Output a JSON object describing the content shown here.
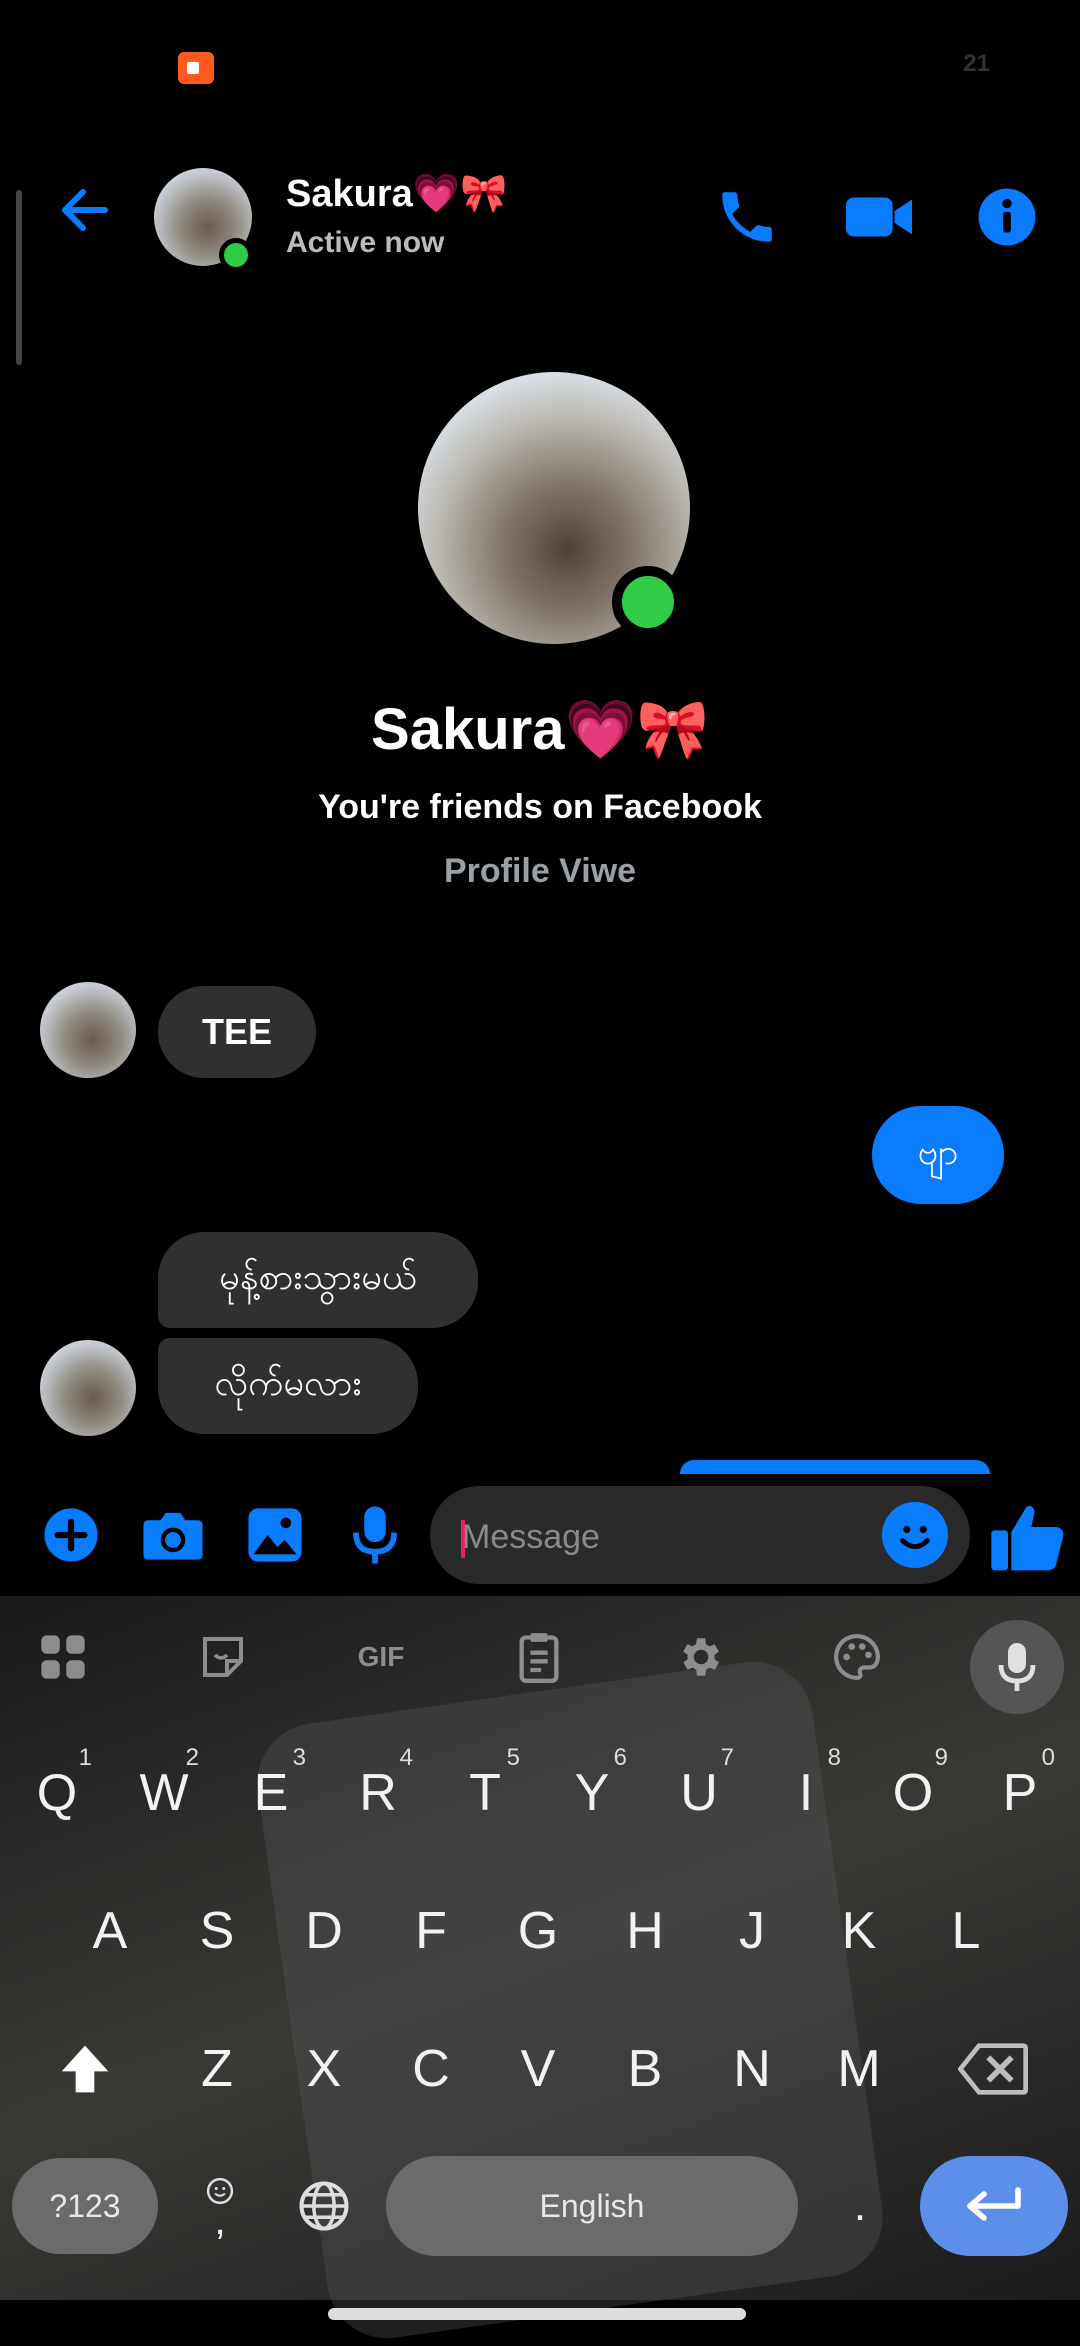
{
  "status": {
    "time": "21"
  },
  "header": {
    "name": "Sakura💗🎀",
    "status": "Active now"
  },
  "profile": {
    "name": "Sakura💗🎀",
    "subtitle": "You're friends on Facebook",
    "link": "Profile Viwe"
  },
  "messages": [
    {
      "side": "in",
      "text": "TEE"
    },
    {
      "side": "out",
      "text": "ဗျာ"
    },
    {
      "side": "in",
      "text": "မုန့်စားသွားမယ်"
    },
    {
      "side": "in",
      "text": "လိုက်မလား"
    }
  ],
  "composer": {
    "placeholder": "Message"
  },
  "keyboard": {
    "toolbar": [
      "apps-grid-icon",
      "sticker-icon",
      "GIF",
      "clipboard-icon",
      "settings-icon",
      "palette-icon",
      "mic-icon"
    ],
    "gif_label": "GIF",
    "row1": [
      {
        "k": "Q",
        "n": "1"
      },
      {
        "k": "W",
        "n": "2"
      },
      {
        "k": "E",
        "n": "3"
      },
      {
        "k": "R",
        "n": "4"
      },
      {
        "k": "T",
        "n": "5"
      },
      {
        "k": "Y",
        "n": "6"
      },
      {
        "k": "U",
        "n": "7"
      },
      {
        "k": "I",
        "n": "8"
      },
      {
        "k": "O",
        "n": "9"
      },
      {
        "k": "P",
        "n": "0"
      }
    ],
    "row2": [
      "A",
      "S",
      "D",
      "F",
      "G",
      "H",
      "J",
      "K",
      "L"
    ],
    "row3": [
      "Z",
      "X",
      "C",
      "V",
      "B",
      "N",
      "M"
    ],
    "symbols_label": "?123",
    "comma_label": ",",
    "space_label": "English",
    "period_label": "."
  },
  "colors": {
    "accent": "#0a7cff",
    "online": "#31cc46",
    "bubble_in": "#303030",
    "enter": "#5c8fea"
  }
}
